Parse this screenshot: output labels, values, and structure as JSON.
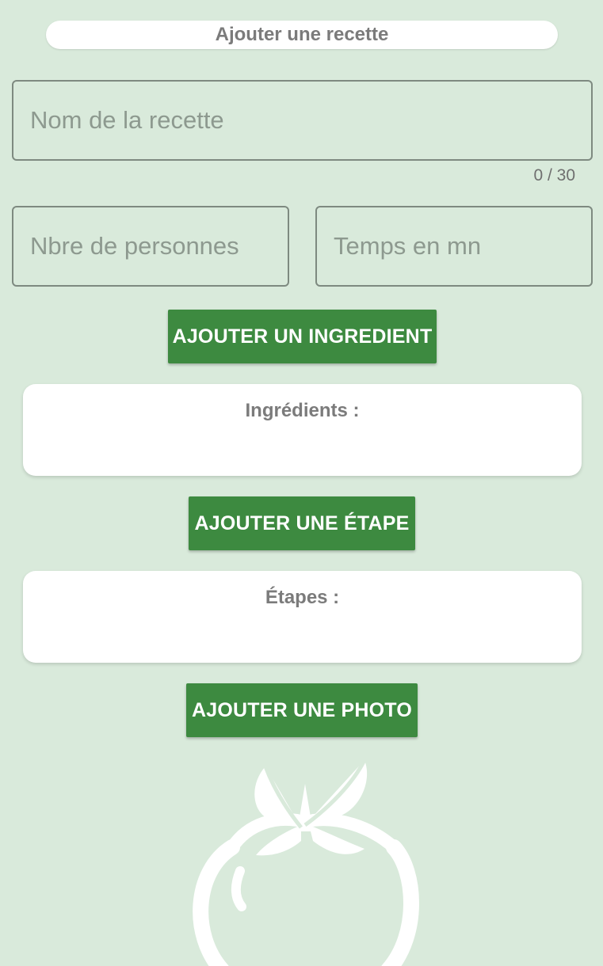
{
  "header": {
    "title": "Ajouter une recette"
  },
  "form": {
    "name_placeholder": "Nom de la recette",
    "name_counter": "0 / 30",
    "persons_placeholder": "Nbre de personnes",
    "time_placeholder": "Temps en mn"
  },
  "buttons": {
    "add_ingredient": "AJOUTER UN INGREDIENT",
    "add_step": "AJOUTER UNE ÉTAPE",
    "add_photo": "AJOUTER UNE PHOTO"
  },
  "sections": {
    "ingredients_title": "Ingrédients :",
    "steps_title": "Étapes :"
  },
  "illustration": {
    "icon": "tomato-icon"
  },
  "colors": {
    "background": "#d9eadb",
    "primary_button": "#3d8a40",
    "card": "#ffffff",
    "field_border": "#7e8a80"
  }
}
